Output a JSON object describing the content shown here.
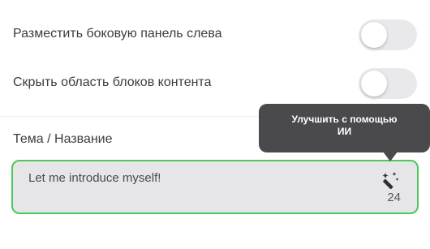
{
  "settings": {
    "items": [
      {
        "label": "Разместить боковую панель слева",
        "enabled": false
      },
      {
        "label": "Скрыть область блоков контента",
        "enabled": false
      }
    ]
  },
  "topic_field": {
    "label": "Тема / Название",
    "value": "Let me introduce myself!",
    "char_count": "24",
    "border_color": "#4cc85a",
    "ai_button_icon": "magic-wand-icon"
  },
  "tooltip": {
    "line1": "Улучшить с помощью",
    "line2": "ИИ"
  }
}
